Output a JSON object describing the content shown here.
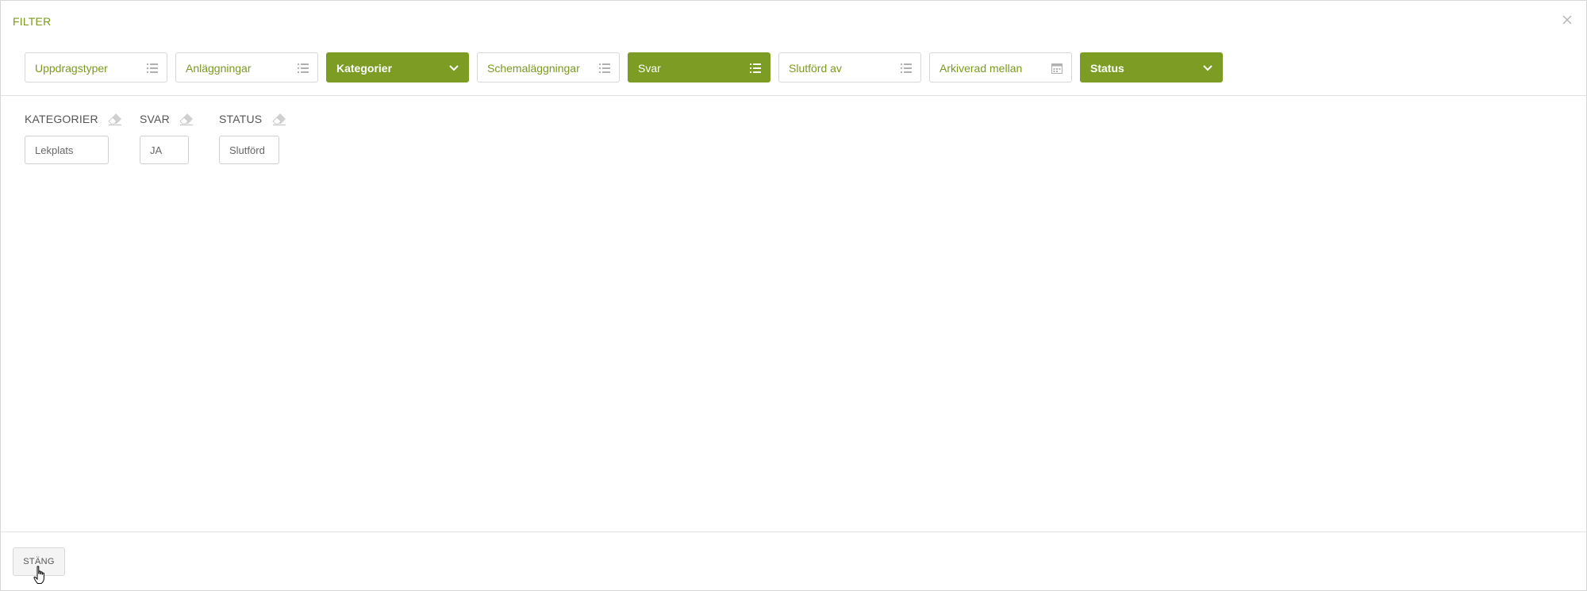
{
  "dialog": {
    "title": "FILTER",
    "close_icon": "close-icon"
  },
  "filters": [
    {
      "label": "Uppdragstyper",
      "icon": "list-icon",
      "active": false
    },
    {
      "label": "Anläggningar",
      "icon": "list-icon",
      "active": false
    },
    {
      "label": "Kategorier",
      "icon": "chevron-down-icon",
      "active": true
    },
    {
      "label": "Schemaläggningar",
      "icon": "list-icon",
      "active": false
    },
    {
      "label": "Svar",
      "icon": "list-icon",
      "active": true
    },
    {
      "label": "Slutförd av",
      "icon": "list-icon",
      "active": false
    },
    {
      "label": "Arkiverad mellan",
      "icon": "calendar-icon",
      "active": false
    },
    {
      "label": "Status",
      "icon": "chevron-down-icon",
      "active": true
    }
  ],
  "selected": {
    "kategorier": {
      "title": "KATEGORIER",
      "chips": [
        "Lekplats"
      ]
    },
    "svar": {
      "title": "SVAR",
      "chips": [
        "JA"
      ]
    },
    "status": {
      "title": "STATUS",
      "chips": [
        "Slutförd"
      ]
    }
  },
  "footer": {
    "close_label": "STÄNG"
  },
  "colors": {
    "accent": "#7d9c23",
    "accent_text": "#7a9a1e",
    "border": "#d7d7d7"
  }
}
